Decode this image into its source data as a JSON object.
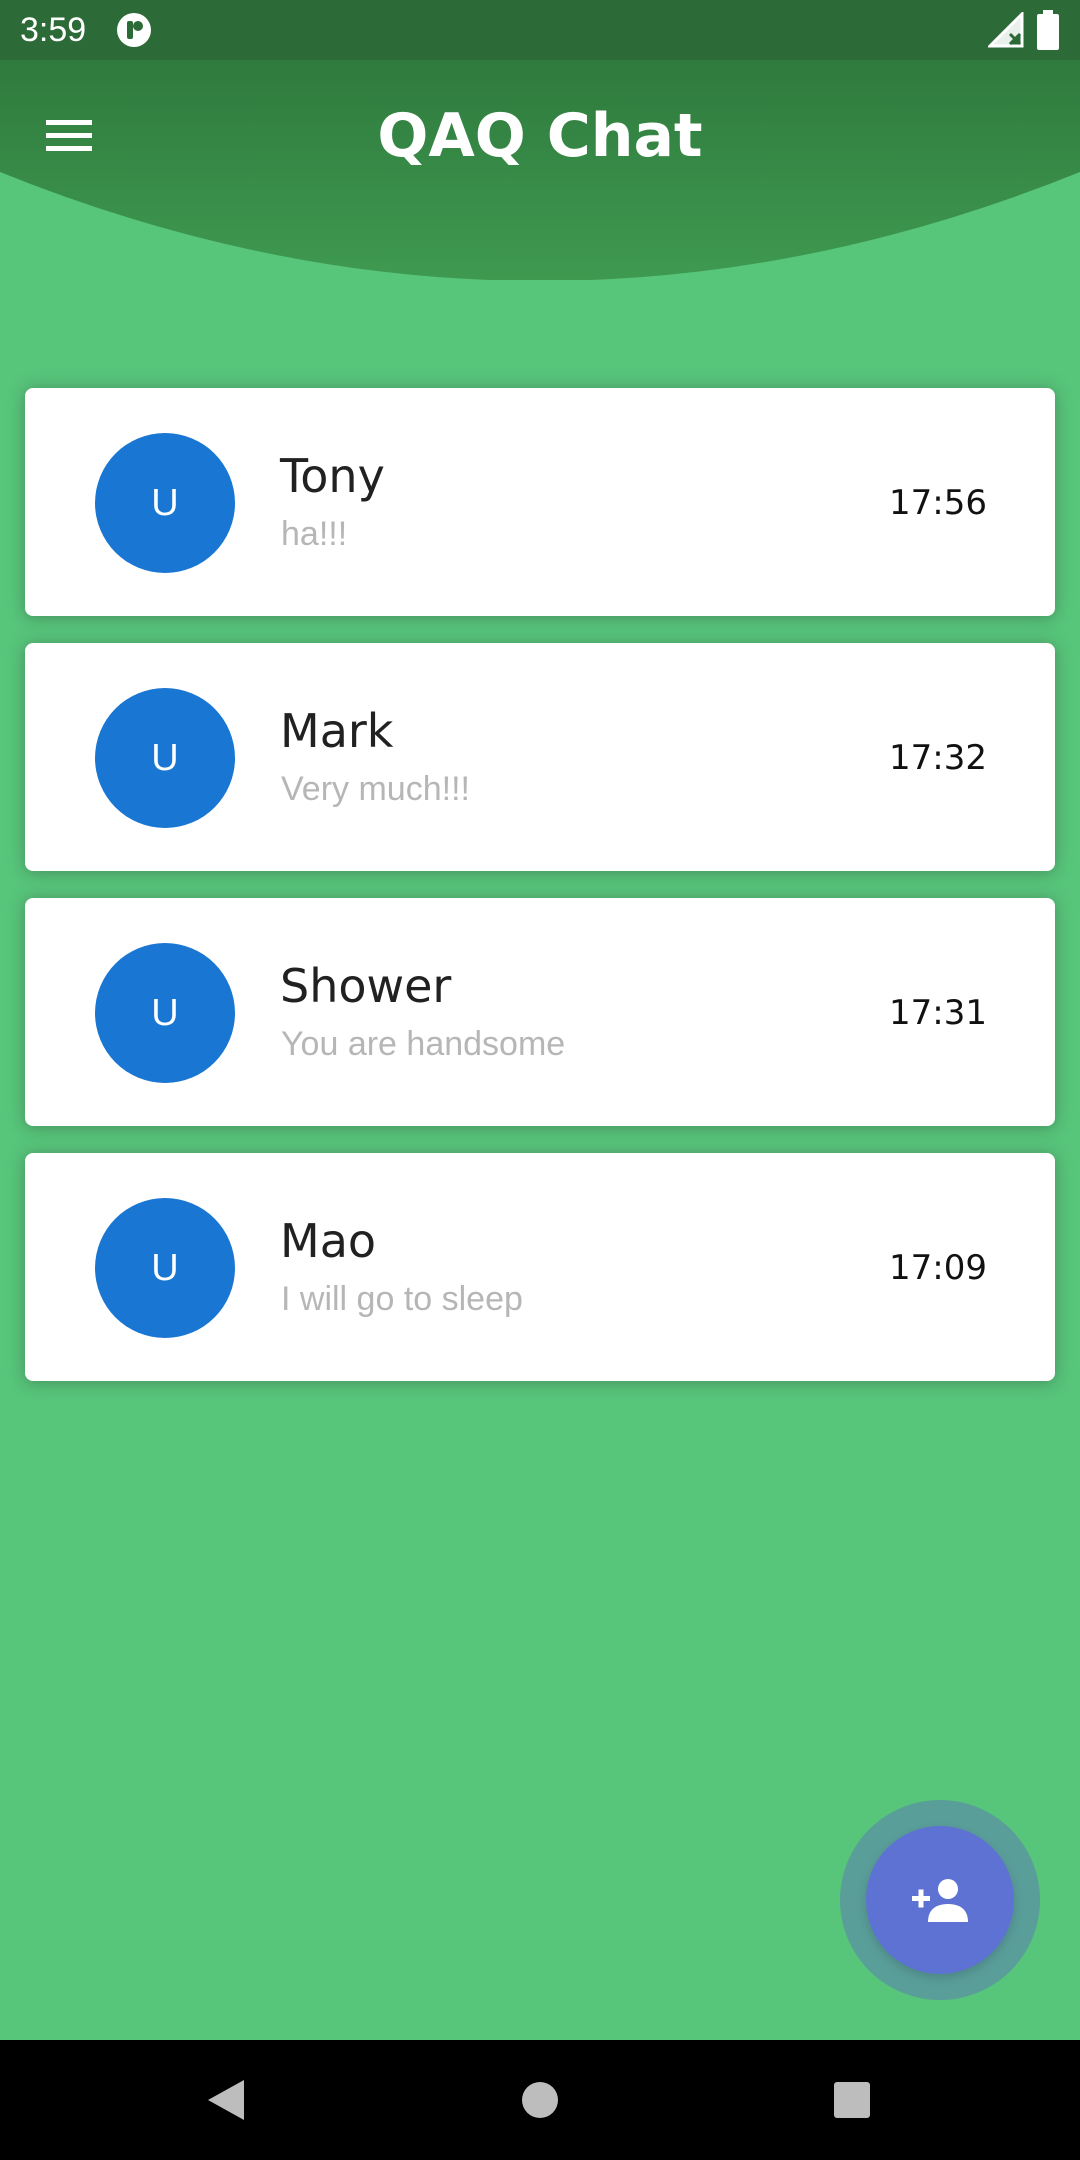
{
  "status_bar": {
    "time": "3:59",
    "icons": [
      "app-notification-icon",
      "signal-off-icon",
      "battery-icon"
    ]
  },
  "app_bar": {
    "title": "QAQ Chat",
    "menu_icon": "hamburger-menu-icon",
    "background_color": "#2f7d3f"
  },
  "chats": [
    {
      "avatar_initial": "U",
      "name": "Tony",
      "preview": "ha!!!",
      "time": "17:56"
    },
    {
      "avatar_initial": "U",
      "name": "Mark",
      "preview": "Very much!!!",
      "time": "17:32"
    },
    {
      "avatar_initial": "U",
      "name": "Shower",
      "preview": "You are handsome",
      "time": "17:31"
    },
    {
      "avatar_initial": "U",
      "name": "Mao",
      "preview": "I will go to sleep",
      "time": "17:09"
    }
  ],
  "fab": {
    "icon": "add-person-icon",
    "color": "#5e72d4"
  },
  "nav_bar": {
    "buttons": [
      "back-icon",
      "home-icon",
      "recents-icon"
    ]
  },
  "colors": {
    "background": "#57c57a",
    "avatar": "#1976d2",
    "preview_text": "#b6b6b6"
  }
}
